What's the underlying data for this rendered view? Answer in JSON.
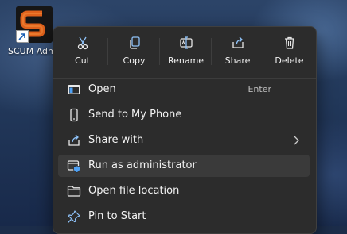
{
  "desktop": {
    "shortcut_label": "SCUM Admin Helper",
    "icon": "scum-s-logo-icon"
  },
  "toolbar": [
    {
      "label": "Cut",
      "icon": "scissors-icon"
    },
    {
      "label": "Copy",
      "icon": "copy-icon"
    },
    {
      "label": "Rename",
      "icon": "rename-icon"
    },
    {
      "label": "Share",
      "icon": "share-icon"
    },
    {
      "label": "Delete",
      "icon": "trash-icon"
    }
  ],
  "menu_items": [
    {
      "label": "Open",
      "shortcut": "Enter",
      "icon": "open-app-icon"
    },
    {
      "label": "Send to My Phone",
      "icon": "phone-icon"
    },
    {
      "label": "Share with",
      "icon": "share-with-icon",
      "submenu": true
    },
    {
      "label": "Run as administrator",
      "icon": "shield-icon",
      "highlighted": true
    },
    {
      "label": "Open file location",
      "icon": "folder-icon"
    },
    {
      "label": "Pin to Start",
      "icon": "pin-icon"
    }
  ],
  "colors": {
    "menu_bg": "#2c2c2c",
    "hover_bg": "#3a3a3a",
    "accent": "#4ea1f5",
    "logo_orange": "#e0621c"
  }
}
